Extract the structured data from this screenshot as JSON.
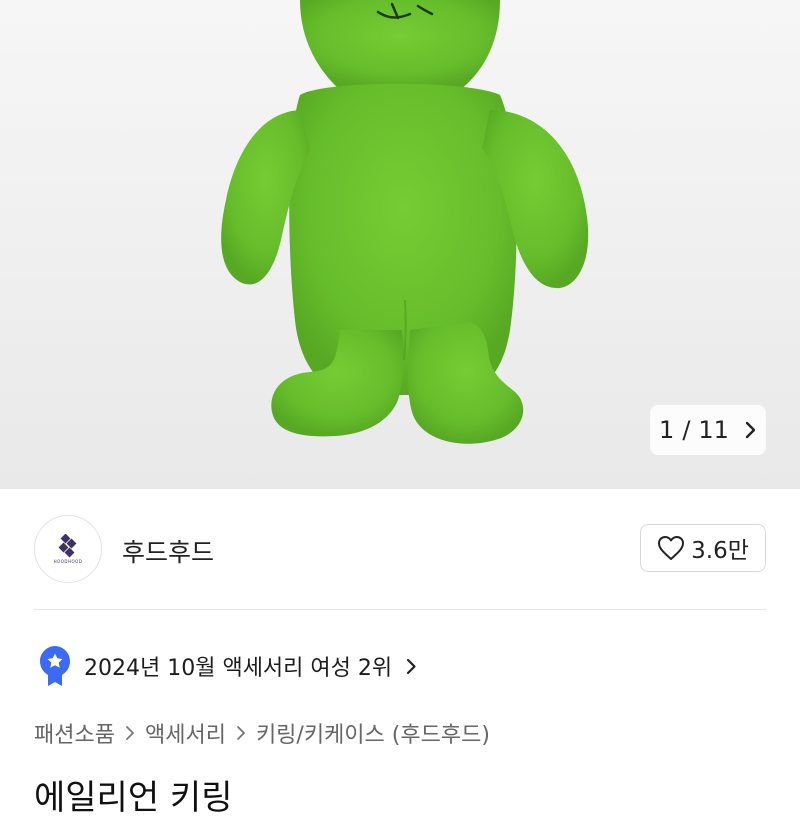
{
  "gallery": {
    "current": "1",
    "separator": "/",
    "total": "11",
    "image_alt": "green plush bear keyring"
  },
  "brand": {
    "name": "후드후드",
    "logo_icon": "diamond-logo-icon",
    "logo_small_text": "HOODHOOD",
    "likes": "3.6만"
  },
  "ranking": {
    "text": "2024년 10월 액세서리 여성 2위",
    "icon": "star-badge-icon",
    "accent": "#3b6af5"
  },
  "breadcrumb": [
    "패션소품",
    "액세서리",
    "키링/키케이스 (후드후드)"
  ],
  "product": {
    "title": "에일리언 키링"
  },
  "colors": {
    "plush_green": "#6cc22c",
    "divider": "#e6e6e6"
  }
}
